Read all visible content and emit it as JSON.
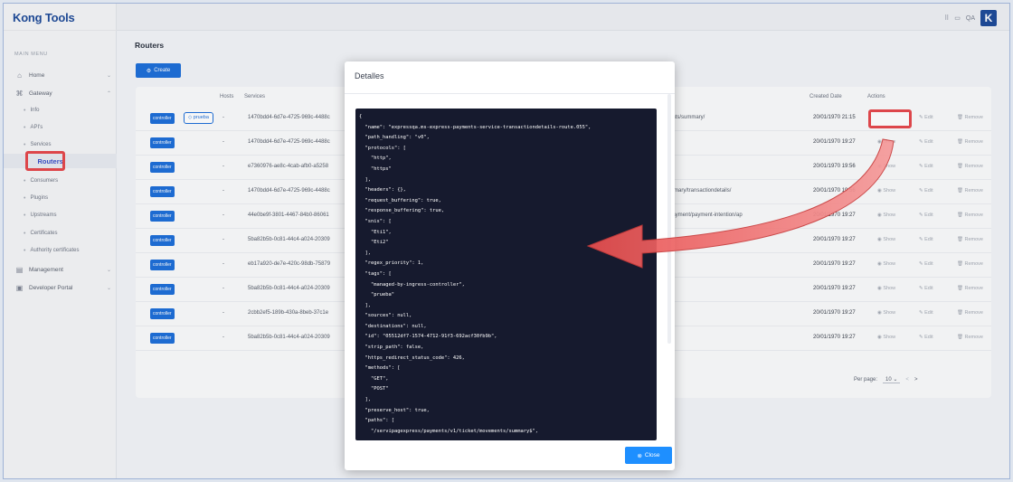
{
  "app": {
    "logo": "Kong Tools"
  },
  "sidebar": {
    "menu_label": "MAIN MENU",
    "items": [
      {
        "label": "Home",
        "icon": "home-icon"
      },
      {
        "label": "Gateway",
        "icon": "gateway-icon"
      },
      {
        "label": "Management",
        "icon": "management-icon"
      },
      {
        "label": "Developer Portal",
        "icon": "portal-icon"
      }
    ],
    "gateway_children": [
      "Info",
      "API's",
      "Services",
      "Routers",
      "Consumers",
      "Plugins",
      "Upstreams",
      "Certificates",
      "Authority certificates"
    ],
    "active_child": "Routers",
    "collapse": "<"
  },
  "topbar": {
    "env": "QA"
  },
  "page": {
    "title": "Routers",
    "create_label": "Create",
    "columns": {
      "hosts": "Hosts",
      "services": "Services",
      "created": "Created Date",
      "actions": "Actions"
    },
    "rows": [
      {
        "tag": "controller",
        "tag2": "prueba",
        "hosts": "-",
        "service": "1470bdd4-6d7e-4725-969c-4488c",
        "path": "ents/summary/",
        "date": "20/01/1970 21:15"
      },
      {
        "tag": "controller",
        "hosts": "-",
        "service": "1470bdd4-6d7e-4725-969c-4488c",
        "path": "",
        "date": "20/01/1970 19:27"
      },
      {
        "tag": "controller",
        "hosts": "-",
        "service": "e7360976-ae8c-4cab-afb0-a5258",
        "path": "",
        "date": "20/01/1970 19:56"
      },
      {
        "tag": "controller",
        "hosts": "-",
        "service": "1470bdd4-6d7e-4725-969c-4488c",
        "path": "mmary/transactiondetails/",
        "date": "20/01/1970 19:56"
      },
      {
        "tag": "controller",
        "hosts": "-",
        "service": "44e0be9f-3801-4467-84b0-86061",
        "path": "payment/payment-intention/ap",
        "date": "20/01/1970 19:27"
      },
      {
        "tag": "controller",
        "hosts": "-",
        "service": "5ba82b5b-0c81-44c4-a024-20309",
        "path": "",
        "date": "20/01/1970 19:27"
      },
      {
        "tag": "controller",
        "hosts": "-",
        "service": "eb17a920-de7e-420c-98db-75879",
        "path": "",
        "date": "20/01/1970 19:27"
      },
      {
        "tag": "controller",
        "hosts": "-",
        "service": "5ba82b5b-0c81-44c4-a024-20309",
        "path": "",
        "date": "20/01/1970 19:27"
      },
      {
        "tag": "controller",
        "hosts": "-",
        "service": "2cbb2ef5-189b-430a-8beb-37c1e",
        "path": "",
        "date": "20/01/1970 19:27"
      },
      {
        "tag": "controller",
        "hosts": "-",
        "service": "5ba82b5b-0c81-44c4-a024-20309",
        "path": "",
        "date": "20/01/1970 19:27"
      }
    ],
    "actions": {
      "show": "Show",
      "edit": "Edit",
      "remove": "Remove"
    },
    "pager": {
      "label": "Per page:",
      "value": "10",
      "prev": "<",
      "next": ">"
    }
  },
  "modal": {
    "title": "Detalles",
    "close_label": "Close",
    "json_text": "{\n  \"name\": \"expressqa.ms-express-payments-service-transactiondetails-route.055\",\n  \"path_handling\": \"v0\",\n  \"protocols\": [\n    \"http\",\n    \"https\"\n  ],\n  \"headers\": {},\n  \"request_buffering\": true,\n  \"response_buffering\": true,\n  \"snis\": [\n    \"Eti1\",\n    \"Eti2\"\n  ],\n  \"regex_priority\": 1,\n  \"tags\": [\n    \"managed-by-ingress-controller\",\n    \"prueba\"\n  ],\n  \"sources\": null,\n  \"destinations\": null,\n  \"id\": \"05512df7-1574-4712-91f3-692acf30fb9b\",\n  \"strip_path\": false,\n  \"https_redirect_status_code\": 426,\n  \"methods\": [\n    \"GET\",\n    \"POST\"\n  ],\n  \"preserve_host\": true,\n  \"paths\": [\n    \"/servipagexpress/payments/v1/ticket/movements/summary$\","
  },
  "colors": {
    "accent": "#1e6fd9",
    "highlight": "#e5484d",
    "code_bg": "#161a2e"
  }
}
